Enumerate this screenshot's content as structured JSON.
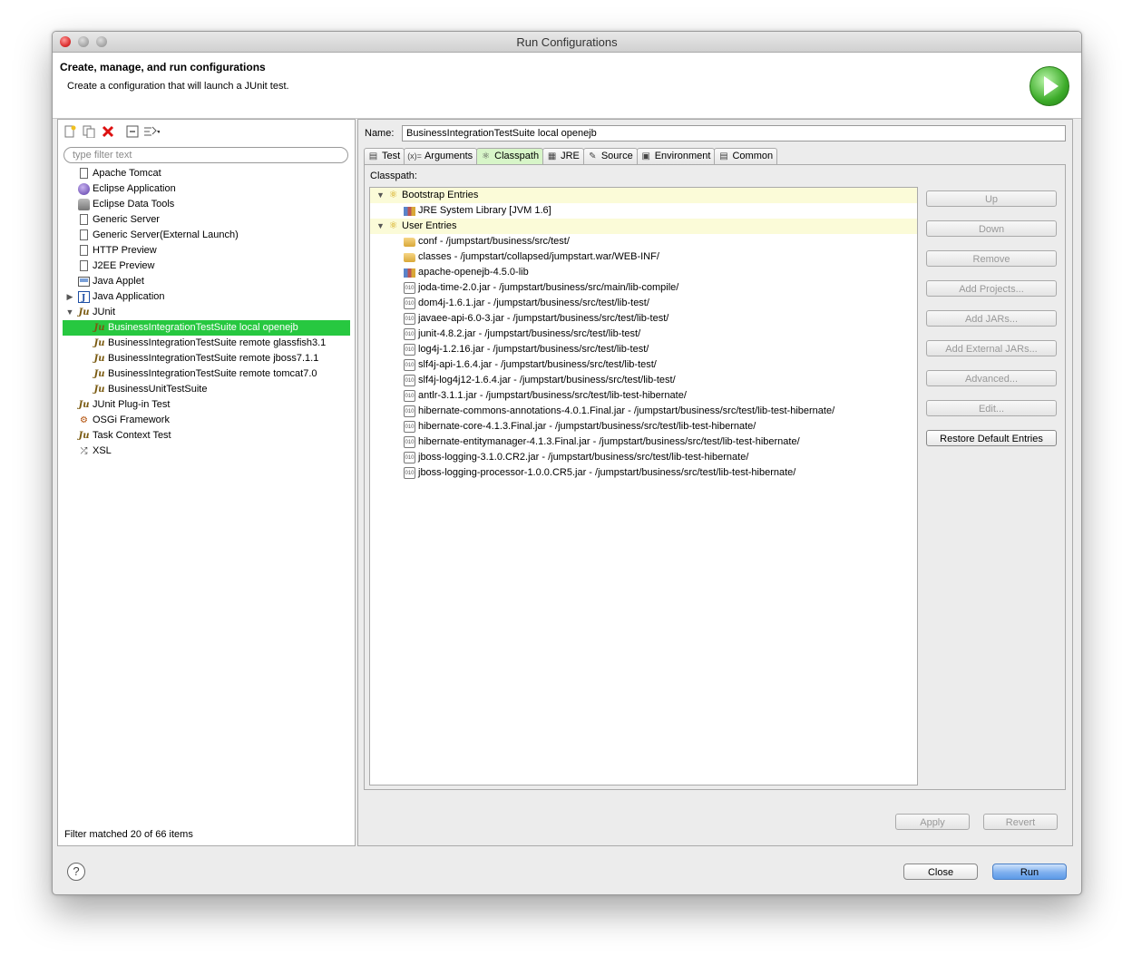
{
  "window": {
    "title": "Run Configurations"
  },
  "header": {
    "title": "Create, manage, and run configurations",
    "description": "Create a configuration that will launch a JUnit test."
  },
  "left": {
    "filter_placeholder": "type filter text",
    "status": "Filter matched 20 of 66 items",
    "tree": [
      {
        "label": "Apache Tomcat",
        "icon": "page-icon",
        "level": 1
      },
      {
        "label": "Eclipse Application",
        "icon": "globe-icon",
        "level": 1
      },
      {
        "label": "Eclipse Data Tools",
        "icon": "database-icon",
        "level": 1
      },
      {
        "label": "Generic Server",
        "icon": "page-icon",
        "level": 1
      },
      {
        "label": "Generic Server(External Launch)",
        "icon": "page-icon",
        "level": 1
      },
      {
        "label": "HTTP Preview",
        "icon": "page-icon",
        "level": 1
      },
      {
        "label": "J2EE Preview",
        "icon": "page-icon",
        "level": 1
      },
      {
        "label": "Java Applet",
        "icon": "applet-icon",
        "level": 1
      },
      {
        "label": "Java Application",
        "icon": "java-app-icon",
        "level": 1,
        "expander": "collapsed"
      },
      {
        "label": "JUnit",
        "icon": "junit-icon",
        "level": 1,
        "expander": "expanded"
      },
      {
        "label": "BusinessIntegrationTestSuite local openejb",
        "icon": "junit-icon",
        "level": 2,
        "selected": true
      },
      {
        "label": "BusinessIntegrationTestSuite remote glassfish3.1",
        "icon": "junit-icon",
        "level": 2
      },
      {
        "label": "BusinessIntegrationTestSuite remote jboss7.1.1",
        "icon": "junit-icon",
        "level": 2
      },
      {
        "label": "BusinessIntegrationTestSuite remote tomcat7.0",
        "icon": "junit-icon",
        "level": 2
      },
      {
        "label": "BusinessUnitTestSuite",
        "icon": "junit-icon",
        "level": 2
      },
      {
        "label": "JUnit Plug-in Test",
        "icon": "junit-plugin-icon",
        "level": 1
      },
      {
        "label": "OSGi Framework",
        "icon": "osgi-icon",
        "level": 1
      },
      {
        "label": "Task Context Test",
        "icon": "junit-icon",
        "level": 1
      },
      {
        "label": "XSL",
        "icon": "xsl-icon",
        "level": 1
      }
    ]
  },
  "right": {
    "name_label": "Name:",
    "name_value": "BusinessIntegrationTestSuite local openejb",
    "tabs": [
      {
        "label": "Test",
        "icon": "test-tab-icon"
      },
      {
        "label": "Arguments",
        "icon": "arguments-tab-icon",
        "glyph": "(x)="
      },
      {
        "label": "Classpath",
        "icon": "classpath-tab-icon",
        "active": true
      },
      {
        "label": "JRE",
        "icon": "jre-tab-icon"
      },
      {
        "label": "Source",
        "icon": "source-tab-icon"
      },
      {
        "label": "Environment",
        "icon": "environment-tab-icon"
      },
      {
        "label": "Common",
        "icon": "common-tab-icon"
      }
    ],
    "classpath_label": "Classpath:",
    "entries": [
      {
        "label": "Bootstrap Entries",
        "type": "group",
        "icon": "entries-icon"
      },
      {
        "label": "JRE System Library [JVM 1.6]",
        "type": "lib",
        "icon": "library-icon"
      },
      {
        "label": "User Entries",
        "type": "group",
        "icon": "entries-icon"
      },
      {
        "label": "conf - /jumpstart/business/src/test/",
        "type": "folder",
        "icon": "folder-icon"
      },
      {
        "label": "classes - /jumpstart/collapsed/jumpstart.war/WEB-INF/",
        "type": "folder",
        "icon": "folder-icon"
      },
      {
        "label": "apache-openejb-4.5.0-lib",
        "type": "lib",
        "icon": "library-icon"
      },
      {
        "label": "joda-time-2.0.jar - /jumpstart/business/src/main/lib-compile/",
        "type": "jar",
        "icon": "jar-icon"
      },
      {
        "label": "dom4j-1.6.1.jar - /jumpstart/business/src/test/lib-test/",
        "type": "jar",
        "icon": "jar-icon"
      },
      {
        "label": "javaee-api-6.0-3.jar - /jumpstart/business/src/test/lib-test/",
        "type": "jar",
        "icon": "jar-icon"
      },
      {
        "label": "junit-4.8.2.jar - /jumpstart/business/src/test/lib-test/",
        "type": "jar",
        "icon": "jar-icon"
      },
      {
        "label": "log4j-1.2.16.jar - /jumpstart/business/src/test/lib-test/",
        "type": "jar",
        "icon": "jar-icon"
      },
      {
        "label": "slf4j-api-1.6.4.jar - /jumpstart/business/src/test/lib-test/",
        "type": "jar",
        "icon": "jar-icon"
      },
      {
        "label": "slf4j-log4j12-1.6.4.jar - /jumpstart/business/src/test/lib-test/",
        "type": "jar",
        "icon": "jar-icon"
      },
      {
        "label": "antlr-3.1.1.jar - /jumpstart/business/src/test/lib-test-hibernate/",
        "type": "jar",
        "icon": "jar-icon"
      },
      {
        "label": "hibernate-commons-annotations-4.0.1.Final.jar - /jumpstart/business/src/test/lib-test-hibernate/",
        "type": "jar",
        "icon": "jar-icon"
      },
      {
        "label": "hibernate-core-4.1.3.Final.jar - /jumpstart/business/src/test/lib-test-hibernate/",
        "type": "jar",
        "icon": "jar-icon"
      },
      {
        "label": "hibernate-entitymanager-4.1.3.Final.jar - /jumpstart/business/src/test/lib-test-hibernate/",
        "type": "jar",
        "icon": "jar-icon"
      },
      {
        "label": "jboss-logging-3.1.0.CR2.jar - /jumpstart/business/src/test/lib-test-hibernate/",
        "type": "jar",
        "icon": "jar-icon"
      },
      {
        "label": "jboss-logging-processor-1.0.0.CR5.jar - /jumpstart/business/src/test/lib-test-hibernate/",
        "type": "jar",
        "icon": "jar-icon"
      }
    ],
    "buttons": [
      {
        "label": "Up",
        "enabled": false
      },
      {
        "label": "Down",
        "enabled": false
      },
      {
        "label": "Remove",
        "enabled": false
      },
      {
        "label": "Add Projects...",
        "enabled": false
      },
      {
        "label": "Add JARs...",
        "enabled": false
      },
      {
        "label": "Add External JARs...",
        "enabled": false
      },
      {
        "label": "Advanced...",
        "enabled": false
      },
      {
        "label": "Edit...",
        "enabled": false
      },
      {
        "label": "Restore Default Entries",
        "enabled": true
      }
    ],
    "apply_label": "Apply",
    "revert_label": "Revert"
  },
  "footer": {
    "help_glyph": "?",
    "close_label": "Close",
    "run_label": "Run"
  },
  "colors": {
    "selection": "#27c840",
    "group_highlight": "#fbfbd8",
    "active_tab": "#d7f5c8",
    "run_button": "#7fb0ef"
  }
}
